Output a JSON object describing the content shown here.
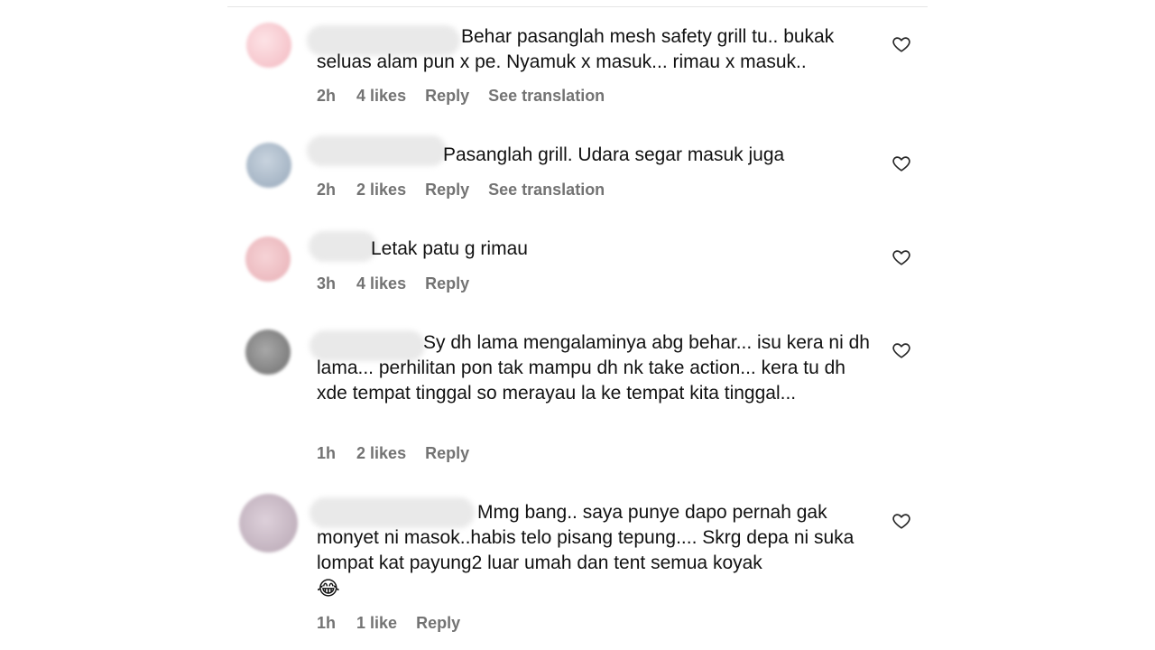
{
  "comments": [
    {
      "text": "Behar pasanglah mesh safety grill tu.. bukak seluas alam pun x pe. Nyamuk x masuk... rimau x masuk..",
      "time": "2h",
      "likes": "4 likes",
      "reply": "Reply",
      "translate": "See translation",
      "avatar_color": "#f7c9cf"
    },
    {
      "text": "Pasanglah grill. Udara segar masuk juga",
      "time": "2h",
      "likes": "2 likes",
      "reply": "Reply",
      "translate": "See translation",
      "avatar_color": "#aebccc"
    },
    {
      "text": "Letak patu g rimau",
      "time": "3h",
      "likes": "4 likes",
      "reply": "Reply",
      "avatar_color": "#f0c4c8"
    },
    {
      "text": "Sy dh lama mengalaminya abg behar... isu kera ni dh lama... perhilitan pon tak mampu dh nk take action... kera tu dh xde tempat tinggal so merayau la ke tempat kita tinggal...",
      "time": "1h",
      "likes": "2 likes",
      "reply": "Reply",
      "avatar_color": "#8c8c8c"
    },
    {
      "text": "Mmg bang.. saya punye dapo pernah gak monyet ni masok..habis telo pisang tepung.... Skrg depa ni suka lompat kat payung2 luar umah dan tent semua koyak",
      "emoji": "😂",
      "time": "1h",
      "likes": "1 like",
      "reply": "Reply",
      "avatar_color": "#c9bcc6"
    }
  ],
  "icons": {
    "like": "heart-outline-icon"
  }
}
